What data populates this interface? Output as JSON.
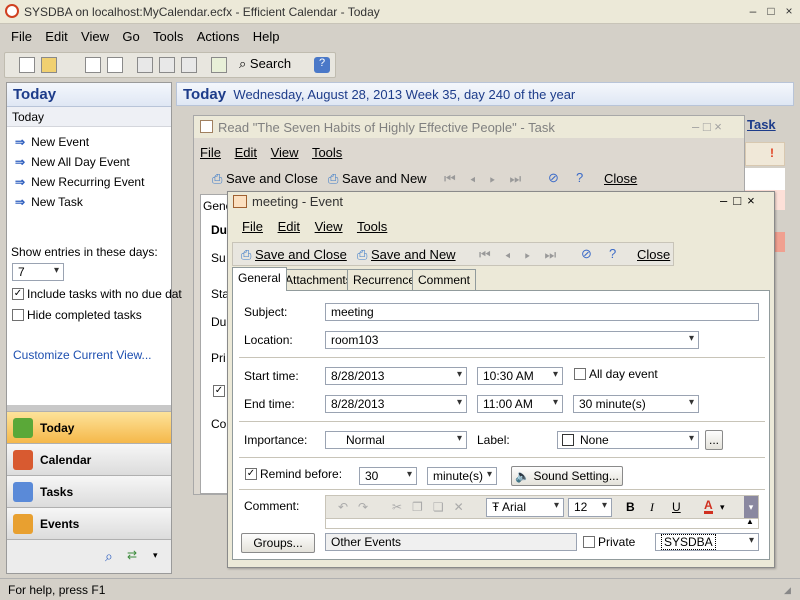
{
  "window": {
    "title": "SYSDBA on localhost:MyCalendar.ecfx - Efficient Calendar - Today",
    "controls": [
      "–",
      "□",
      "×"
    ]
  },
  "menu": [
    "File",
    "Edit",
    "View",
    "Go",
    "Tools",
    "Actions",
    "Help"
  ],
  "toolbar": {
    "search_label": "Search"
  },
  "left": {
    "header": "Today",
    "sub": "Today",
    "tasks": [
      "New Event",
      "New All Day Event",
      "New Recurring Event",
      "New Task"
    ],
    "show_entries_label": "Show entries in these days:",
    "days_value": "7",
    "include_tasks_label": "Include tasks with no due dat",
    "include_tasks_checked": true,
    "hide_completed_label": "Hide completed tasks",
    "hide_completed_checked": false,
    "customize_link": "Customize Current View...",
    "nav": [
      "Today",
      "Calendar",
      "Tasks",
      "Events"
    ]
  },
  "today_bar": {
    "title": "Today",
    "date": "Wednesday, August 28, 2013  Week 35, day 240 of the year",
    "right_link": "Task"
  },
  "task_window": {
    "title": "Read \"The Seven Habits of Highly Effective People\" - Task",
    "menu": [
      "File",
      "Edit",
      "View",
      "Tools"
    ],
    "save_close": "Save and Close",
    "save_new": "Save and New",
    "close": "Close",
    "partial_labels": [
      "Gene",
      "Du",
      "Su",
      "Sta",
      "Du",
      "Pri",
      "Co"
    ]
  },
  "event_window": {
    "title": "meeting - Event",
    "menu": [
      "File",
      "Edit",
      "View",
      "Tools"
    ],
    "save_close": "Save and Close",
    "save_new": "Save and New",
    "close": "Close",
    "tabs": [
      "General",
      "Attachments",
      "Recurrence",
      "Comment"
    ],
    "subject_label": "Subject:",
    "subject": "meeting",
    "location_label": "Location:",
    "location": "room103",
    "start_label": "Start time:",
    "start_date": "8/28/2013",
    "start_time": "10:30 AM",
    "all_day_label": "All day event",
    "end_label": "End time:",
    "end_date": "8/28/2013",
    "end_time": "11:00 AM",
    "duration": "30 minute(s)",
    "importance_label": "Importance:",
    "importance": "Normal",
    "label_label": "Label:",
    "label_value": "None",
    "ellipsis": "...",
    "remind_label": "Remind before:",
    "remind_checked": true,
    "remind_value": "30",
    "remind_unit": "minute(s)",
    "sound_label": "Sound Setting...",
    "comment_label": "Comment:",
    "font_name": "Arial",
    "font_size": "12",
    "fmt_bold": "B",
    "fmt_italic": "I",
    "fmt_underline": "U",
    "fmt_color": "A",
    "groups_button": "Groups...",
    "groups_value": "Other Events",
    "private_label": "Private",
    "owner": "SYSDBA"
  },
  "status": "For help, press F1"
}
